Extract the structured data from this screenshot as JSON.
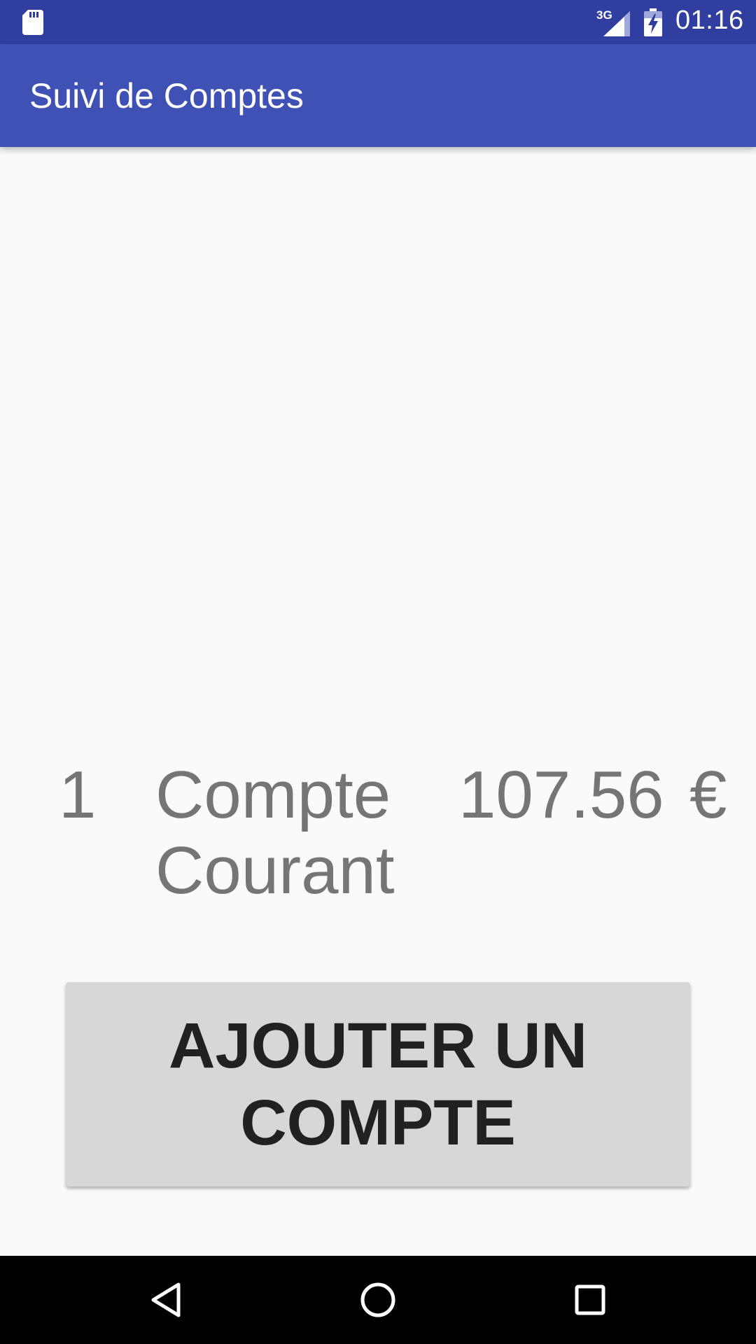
{
  "status_bar": {
    "time": "01:16",
    "network": "3G",
    "icons": [
      "sd-card-icon",
      "cell-signal-icon",
      "battery-charging-icon"
    ],
    "background": "#303f9f"
  },
  "app_bar": {
    "title": "Suivi de Comptes",
    "background": "#3f51b5"
  },
  "accounts": [
    {
      "id": "1",
      "name": "Compte Courant",
      "balance": "107.56",
      "currency": "€"
    }
  ],
  "add_button": {
    "label": "AJOUTER UN COMPTE"
  },
  "nav_bar": {
    "icons": [
      "back-icon",
      "home-icon",
      "recents-icon"
    ]
  },
  "colors": {
    "text_secondary": "#757575",
    "button_bg": "#d6d7d7",
    "button_text": "#212121",
    "page_bg": "#fafafa"
  }
}
